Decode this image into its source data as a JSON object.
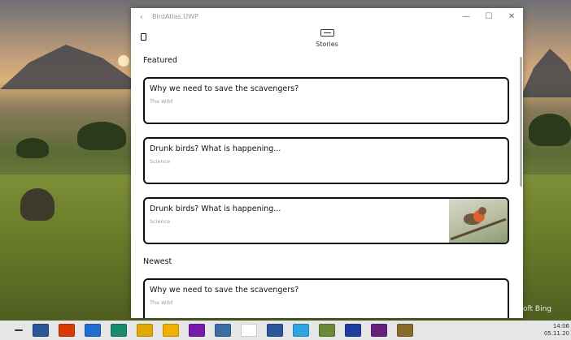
{
  "window": {
    "title": "BirdAtlas.UWP",
    "back_glyph": "‹",
    "minimize_glyph": "—",
    "maximize_glyph": "☐",
    "close_glyph": "✕"
  },
  "header": {
    "stories_label": "Stories",
    "stories_icon": "stories-icon",
    "menu_icon": "hamburger-icon"
  },
  "sections": [
    {
      "title": "Featured",
      "cards": [
        {
          "title": "Why we need to save the scavengers?",
          "subtitle": "The Wild",
          "has_image": false
        },
        {
          "title": "Drunk birds? What is happening...",
          "subtitle": "Science",
          "has_image": false
        },
        {
          "title": "Drunk birds? What is happening...",
          "subtitle": "Science",
          "has_image": true
        }
      ]
    },
    {
      "title": "Newest",
      "cards": [
        {
          "title": "Why we need to save the scavengers?",
          "subtitle": "The Wild",
          "has_image": false
        }
      ]
    }
  ],
  "desktop": {
    "watermark": "soft Bing"
  },
  "taskbar": {
    "icons": [
      "start-icon",
      "task-view-icon",
      "office-icon",
      "mail-icon",
      "edge-icon",
      "chrome-icon",
      "explorer-icon",
      "onenote-icon",
      "network-icon",
      "notepad-icon",
      "word-icon",
      "telegram-icon",
      "app-icon",
      "save-icon",
      "visual-studio-icon",
      "photos-icon"
    ],
    "icon_colors": [
      "#333333",
      "#2b5797",
      "#d83b01",
      "#1e6fd1",
      "#1a8a6e",
      "#e0a800",
      "#f0b000",
      "#7719aa",
      "#3a6ea5",
      "#ffffff",
      "#2b579a",
      "#2ca5e0",
      "#6a8a3a",
      "#1c3f9e",
      "#68217a",
      "#8a6a2a"
    ],
    "time": "14:06",
    "date": "05.11.20"
  }
}
